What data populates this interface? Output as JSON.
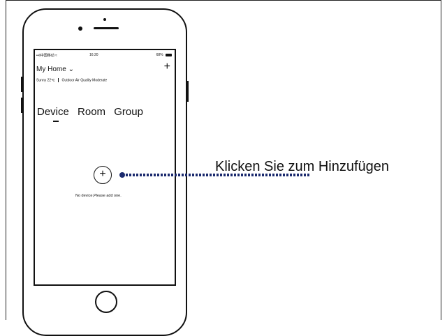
{
  "status_bar": {
    "signal": "••ll中国移动 ≈",
    "time": "16:20",
    "battery": "68%"
  },
  "header": {
    "title": "My Home",
    "title_chevron": "⌄",
    "add_icon": "+"
  },
  "weather": {
    "condition": "Sunny 22℃",
    "air_quality": "Outdoor Air Quality Moderate"
  },
  "tabs": [
    "Device",
    "Room",
    "Group"
  ],
  "empty_state": {
    "add_icon": "+",
    "message": "No device,Please add one."
  },
  "callout": {
    "text": "Klicken Sie zum Hinzufügen",
    "color": "#1b2a6e"
  },
  "icons": [
    "add-icon",
    "chevron-down-icon",
    "battery-icon",
    "signal-icon",
    "home-button-icon"
  ]
}
